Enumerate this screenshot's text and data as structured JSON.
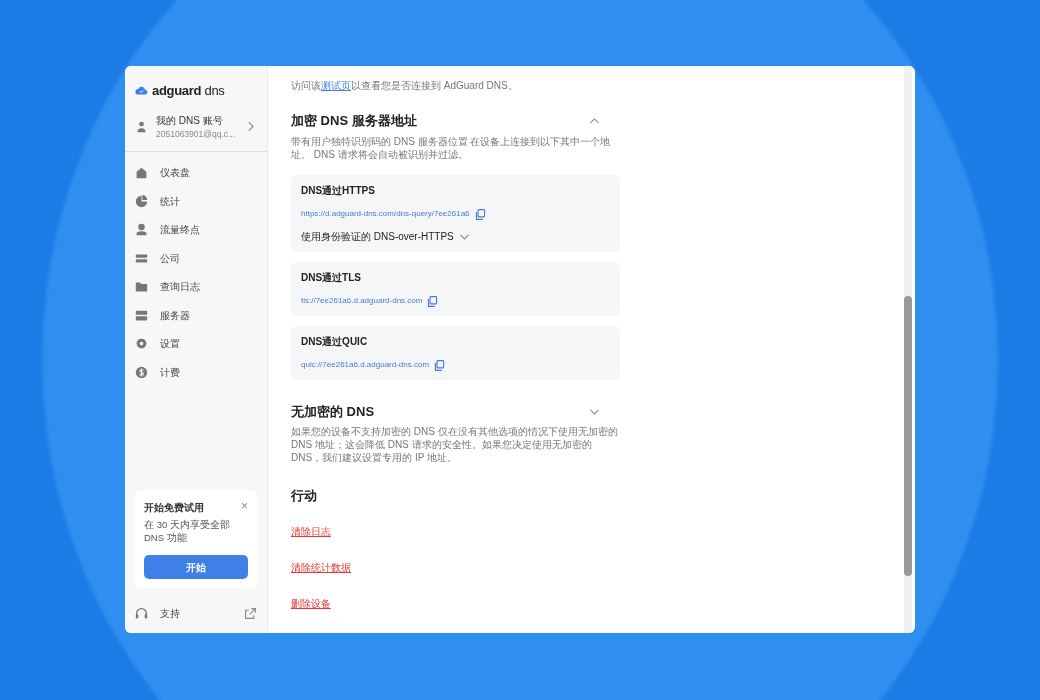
{
  "sidebar": {
    "logo": {
      "brand": "adguard",
      "product": "dns"
    },
    "account": {
      "title": "我的 DNS 账号",
      "email": "2051063901@qq.c..."
    },
    "items": [
      {
        "label": "仪表盘",
        "selected": false
      },
      {
        "label": "统计",
        "selected": false
      },
      {
        "label": "流量终点",
        "selected": false
      },
      {
        "label": "公司",
        "selected": false
      },
      {
        "label": "查询日志",
        "selected": false
      },
      {
        "label": "服务器",
        "selected": false
      },
      {
        "label": "设置",
        "selected": false
      },
      {
        "label": "计费",
        "selected": false
      }
    ],
    "trial": {
      "title": "开始免费试用",
      "text": "在 30 天内享受全部 DNS 功能",
      "button": "开始",
      "close": "×"
    },
    "support": "支持"
  },
  "main": {
    "intro": {
      "before": "访问该",
      "link": "测试页",
      "after": "以查看您是否连接到 AdGuard DNS。"
    },
    "sections": [
      {
        "title": "加密 DNS 服务器地址",
        "expanded": true,
        "description": "带有用户独特识别码的 DNS 服务器位置 在设备上连接到以下其中一个地址。 DNS 请求将会自动被识别并过滤。",
        "cards": [
          {
            "title": "DNS通过HTTPS",
            "address": "https://d.adguard-dns.com/dns-query/7ee261a6",
            "option": "使用身份验证的 DNS-over-HTTPS"
          },
          {
            "title": "DNS通过TLS",
            "address": "tls://7ee261a6.d.adguard-dns.com"
          },
          {
            "title": "DNS通过QUIC",
            "address": "quic://7ee261a6.d.adguard-dns.com"
          }
        ]
      },
      {
        "title": "无加密的 DNS",
        "expanded": false,
        "description": "如果您的设备不支持加密的 DNS 仅在没有其他选项的情况下使用无加密的 DNS 地址；这会降低 DNS 请求的安全性。如果您决定使用无加密的 DNS，我们建议设置专用的 IP 地址。"
      }
    ],
    "actions": {
      "title": "行动",
      "links": [
        "清除日志",
        "清除统计数据",
        "删除设备"
      ]
    }
  }
}
